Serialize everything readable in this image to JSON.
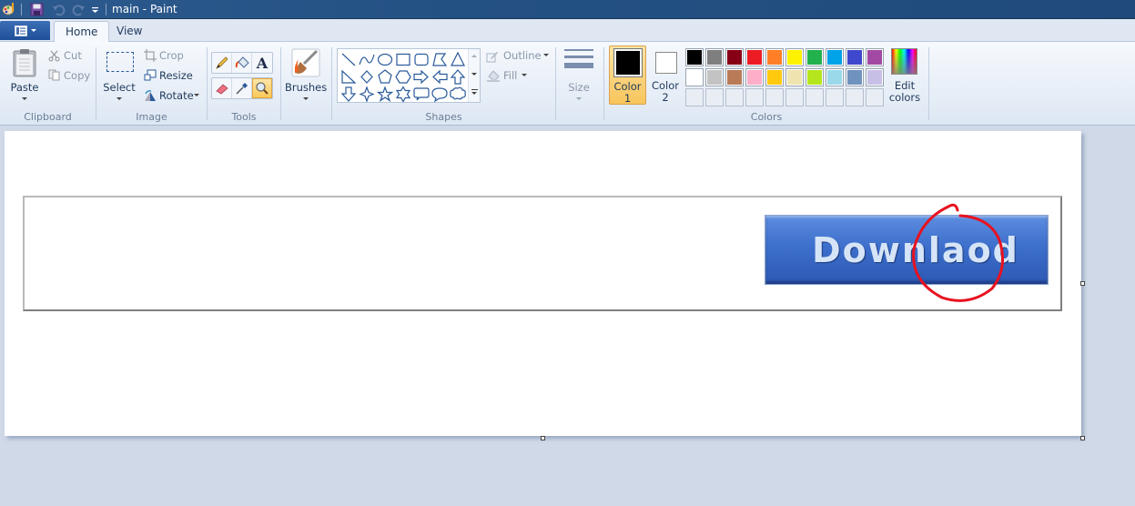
{
  "window": {
    "title": "main - Paint"
  },
  "tabs": [
    {
      "label": "Home",
      "active": true
    },
    {
      "label": "View",
      "active": false
    }
  ],
  "ribbon": {
    "clipboard": {
      "group_label": "Clipboard",
      "paste": "Paste",
      "cut": "Cut",
      "copy": "Copy"
    },
    "image": {
      "group_label": "Image",
      "select": "Select",
      "crop": "Crop",
      "resize": "Resize",
      "rotate": "Rotate"
    },
    "tools": {
      "group_label": "Tools",
      "items": [
        "pencil",
        "fill",
        "text",
        "eraser",
        "color-picker",
        "magnifier"
      ],
      "selected": "magnifier"
    },
    "brushes": {
      "label": "Brushes"
    },
    "shapes": {
      "group_label": "Shapes",
      "outline": "Outline",
      "fill": "Fill",
      "items": [
        "line",
        "curve",
        "oval",
        "rectangle",
        "rounded-rectangle",
        "polygon",
        "triangle",
        "right-triangle",
        "diamond",
        "pentagon",
        "hexagon",
        "right-arrow",
        "left-arrow",
        "up-arrow",
        "down-arrow",
        "four-point-star",
        "five-point-star",
        "six-point-star",
        "rounded-callout",
        "oval-callout",
        "cloud-callout"
      ]
    },
    "size": {
      "label": "Size"
    },
    "colors": {
      "group_label": "Colors",
      "color1_label": "Color",
      "color1_num": "1",
      "color1_value": "#000000",
      "color2_label": "Color",
      "color2_num": "2",
      "color2_value": "#ffffff",
      "edit_label_1": "Edit",
      "edit_label_2": "colors",
      "palette_row1": [
        "#000000",
        "#7f7f7f",
        "#880015",
        "#ed1c24",
        "#ff7f27",
        "#fff200",
        "#22b14c",
        "#00a2e8",
        "#3f48cc",
        "#a349a4"
      ],
      "palette_row2": [
        "#ffffff",
        "#c3c3c3",
        "#b97a57",
        "#ffaec9",
        "#ffc90e",
        "#efe4b0",
        "#b5e61d",
        "#99d9ea",
        "#7092be",
        "#c8bfe7"
      ],
      "palette_row3_empty": 10
    }
  },
  "canvas": {
    "button_text": "Downlaod",
    "annotation_color": "#e8121f"
  }
}
